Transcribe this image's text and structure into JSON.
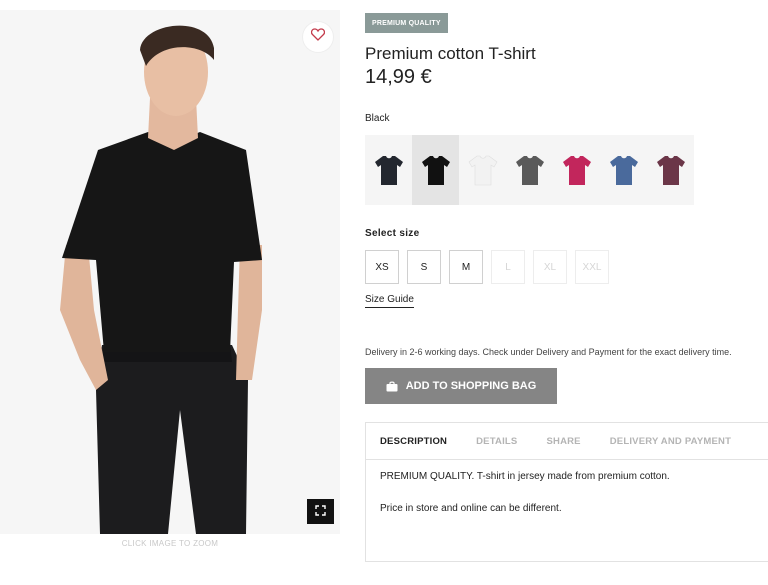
{
  "gallery": {
    "zoom_caption": "CLICK IMAGE TO ZOOM"
  },
  "product": {
    "badge": "PREMIUM QUALITY",
    "title": "Premium cotton T-shirt",
    "price": "14,99 €"
  },
  "colors": {
    "selected_label": "Black",
    "swatches": [
      {
        "name": "dark-navy",
        "color": "#23272f"
      },
      {
        "name": "black",
        "color": "#111111"
      },
      {
        "name": "white",
        "color": "#f2f2f2"
      },
      {
        "name": "dark-grey",
        "color": "#5a5a5a"
      },
      {
        "name": "cerise",
        "color": "#c2265c"
      },
      {
        "name": "blue",
        "color": "#4a6a9c"
      },
      {
        "name": "plum",
        "color": "#6b3648"
      }
    ]
  },
  "size": {
    "label": "Select size",
    "options": [
      {
        "label": "XS",
        "available": true
      },
      {
        "label": "S",
        "available": true
      },
      {
        "label": "M",
        "available": true
      },
      {
        "label": "L",
        "available": false
      },
      {
        "label": "XL",
        "available": false
      },
      {
        "label": "XXL",
        "available": false
      }
    ],
    "guide": "Size Guide"
  },
  "delivery_text": "Delivery in 2-6 working days. Check under Delivery and Payment for the exact delivery time.",
  "add_to_bag": "ADD TO SHOPPING BAG",
  "tabs": {
    "items": [
      "DESCRIPTION",
      "DETAILS",
      "SHARE",
      "DELIVERY AND PAYMENT"
    ],
    "active": "DESCRIPTION",
    "description_lines": [
      "PREMIUM QUALITY. T-shirt in jersey made from premium cotton.",
      "Price in store and online can be different."
    ]
  }
}
